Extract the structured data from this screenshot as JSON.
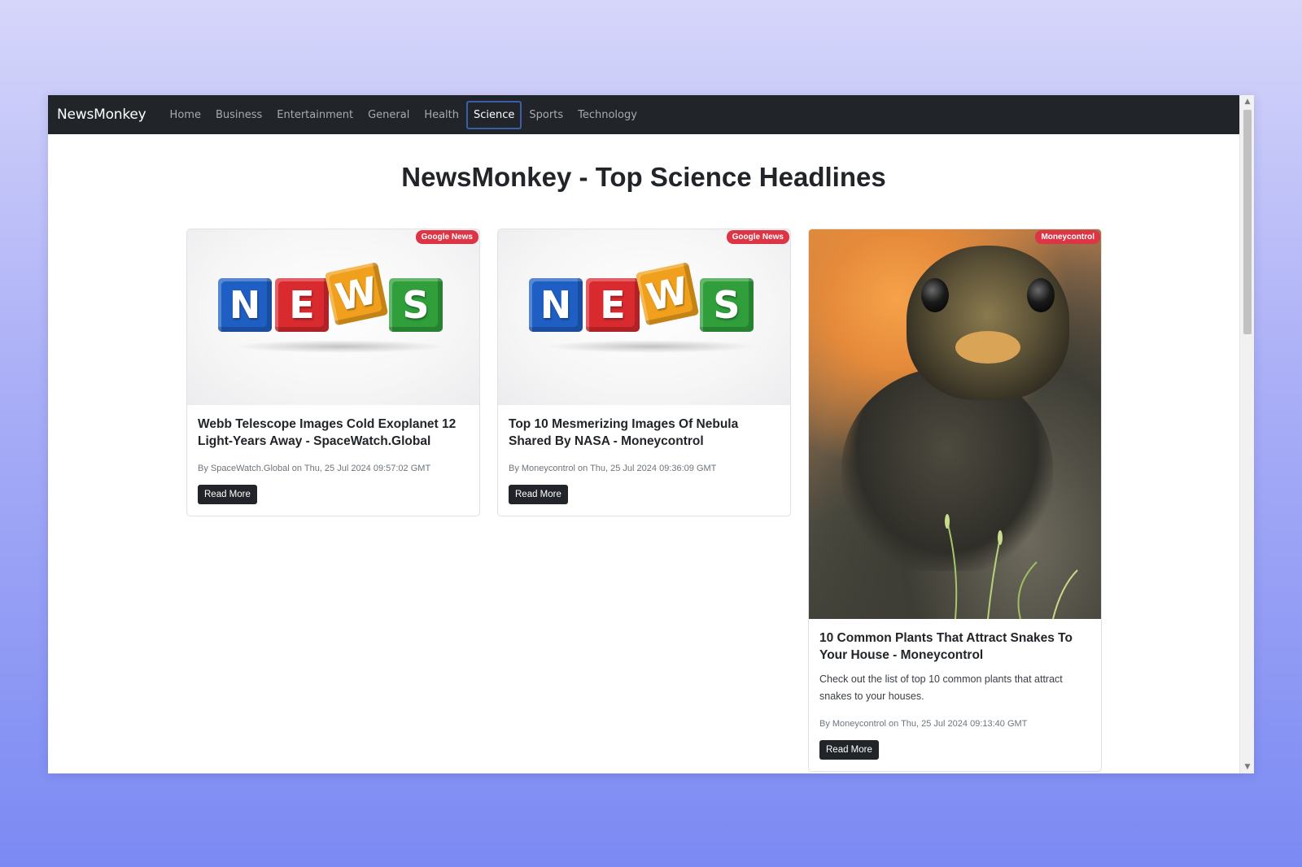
{
  "navbar": {
    "brand": "NewsMonkey",
    "links": [
      "Home",
      "Business",
      "Entertainment",
      "General",
      "Health",
      "Science",
      "Sports",
      "Technology"
    ],
    "active": "Science"
  },
  "page_title": "NewsMonkey - Top Science Headlines",
  "articles": [
    {
      "source": "Google News",
      "image": "news-cubes",
      "cubes": [
        "N",
        "E",
        "W",
        "S"
      ],
      "title": "Webb Telescope Images Cold Exoplanet 12 Light-Years Away - SpaceWatch.Global",
      "meta": "By SpaceWatch.Global on Thu, 25 Jul 2024 09:57:02 GMT",
      "button": "Read More"
    },
    {
      "source": "Google News",
      "image": "news-cubes",
      "cubes": [
        "N",
        "E",
        "W",
        "S"
      ],
      "title": "Top 10 Mesmerizing Images Of Nebula Shared By NASA - Moneycontrol",
      "meta": "By Moneycontrol on Thu, 25 Jul 2024 09:36:09 GMT",
      "button": "Read More"
    },
    {
      "source": "Moneycontrol",
      "image": "snake-photo",
      "title": "10 Common Plants That Attract Snakes To Your House - Moneycontrol",
      "description": "Check out the list of top 10 common plants that attract snakes to your houses.",
      "meta": "By Moneycontrol on Thu, 25 Jul 2024 09:13:40 GMT",
      "button": "Read More"
    }
  ],
  "colors": {
    "navbar_bg": "#212529",
    "badge_bg": "#dc3545",
    "button_bg": "#212529",
    "page_bg_top": "#d6d6fa",
    "page_bg_bottom": "#7b8af3"
  }
}
